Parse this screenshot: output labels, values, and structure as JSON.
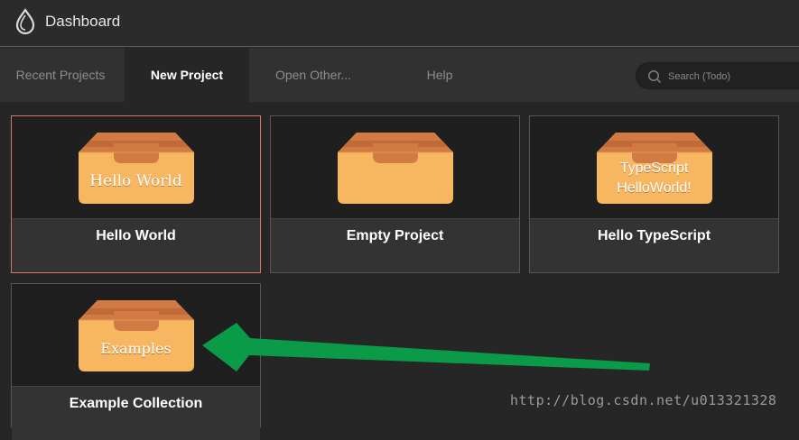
{
  "header": {
    "title": "Dashboard",
    "logo_icon": "drop-logo-icon"
  },
  "tabs": [
    {
      "label": "Recent Projects",
      "active": false
    },
    {
      "label": "New Project",
      "active": true
    },
    {
      "label": "Open Other...",
      "active": false
    },
    {
      "label": "Help",
      "active": false
    }
  ],
  "search": {
    "placeholder": "Search (Todo)"
  },
  "projects": [
    {
      "label": "Hello World",
      "box_text": "Hello World",
      "selected": true
    },
    {
      "label": "Empty Project",
      "box_text": "",
      "selected": false
    },
    {
      "label": "Hello TypeScript",
      "box_text_line1": "TypeScript",
      "box_text_line2": "HelloWorld!",
      "selected": false
    },
    {
      "label": "Example Collection",
      "box_text": "Examples",
      "selected": false
    }
  ],
  "annotation": {
    "arrow_color": "#0a9a48"
  },
  "watermark": "http://blog.csdn.net/u013321328",
  "colors": {
    "accent_border": "#d9765f",
    "box_body": "#f7b660",
    "box_inner": "#d27a43"
  }
}
